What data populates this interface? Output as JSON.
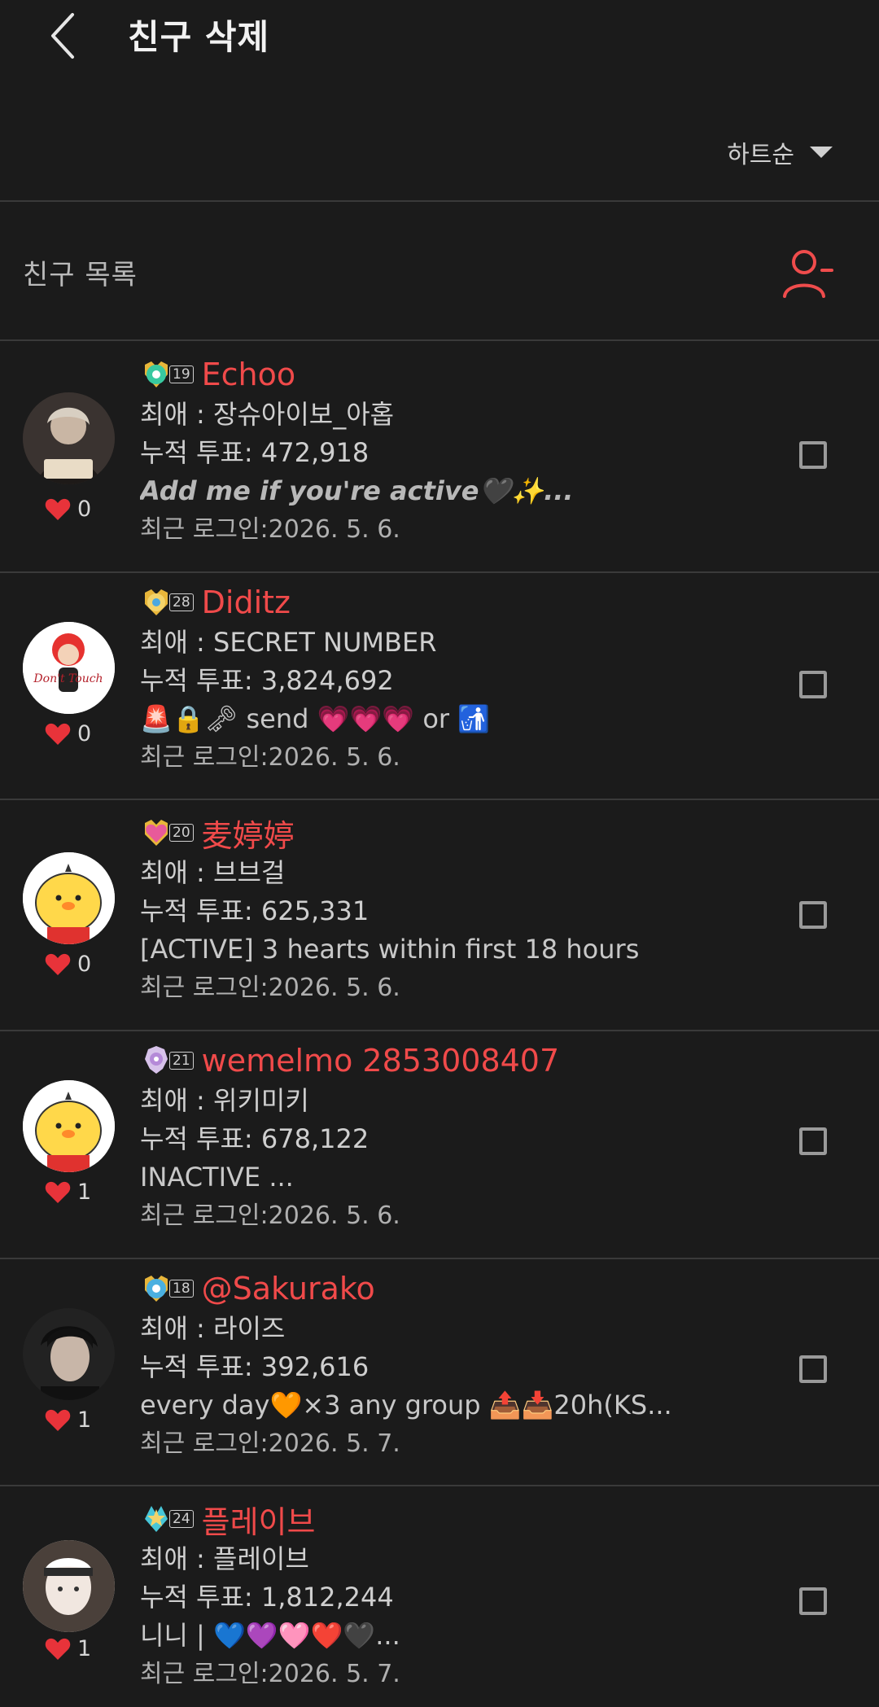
{
  "header": {
    "title": "친구 삭제"
  },
  "sort": {
    "label": "하트순"
  },
  "list": {
    "title": "친구 목록"
  },
  "friends": [
    {
      "name": "Echoo",
      "level": "19",
      "hearts": "0",
      "fav": "최애 : 장슈아이보_아홉",
      "votes": "누적 투표: 472,918",
      "status": "Add me if you're active🖤✨...",
      "login": "최근 로그인:2026. 5. 6.",
      "badge_color": "#38c9a0",
      "avatar": "photo-reading"
    },
    {
      "name": "Diditz",
      "level": "28",
      "hearts": "0",
      "fav": "최애 : SECRET NUMBER",
      "votes": "누적 투표: 3,824,692",
      "status": "🚨🔒🗝 send 💗💗💗 or 🚮",
      "login": "최근 로그인:2026. 5. 6.",
      "badge_color": "#e8b63a",
      "avatar": "dont-touch"
    },
    {
      "name": "麦婷婷",
      "level": "20",
      "hearts": "0",
      "fav": "최애 : 브브걸",
      "votes": "누적 투표: 625,331",
      "status": "[ACTIVE] 3 hearts within first 18 hours",
      "login": "최근 로그인:2026. 5. 6.",
      "badge_color": "#e85a9a",
      "avatar": "chick"
    },
    {
      "name": "wemelmo 2853008407",
      "level": "21",
      "hearts": "1",
      "fav": "최애 : 위키미키",
      "votes": "누적 투표: 678,122",
      "status": "INACTIVE ...",
      "login": "최근 로그인:2026. 5. 6.",
      "badge_color": "#b58ad8",
      "avatar": "chick"
    },
    {
      "name": "@Sakurako",
      "level": "18",
      "hearts": "1",
      "fav": "최애 : 라이즈",
      "votes": "누적 투표: 392,616",
      "status": "every day🧡×3   any group 📤📥20h(KS...",
      "login": "최근 로그인:2026. 5. 7.",
      "badge_color": "#4ab0e0",
      "avatar": "photo-dark"
    },
    {
      "name": "플레이브",
      "level": "24",
      "hearts": "1",
      "fav": "최애 : 플레이브",
      "votes": "누적 투표: 1,812,244",
      "status": "니니 | 💙💜🩷❤️🖤...",
      "login": "최근 로그인:2026. 5. 7.",
      "badge_color": "#47c6d8",
      "avatar": "photo-light"
    }
  ],
  "colors": {
    "accent": "#f04a4a",
    "background": "#1b1b1b",
    "divider": "#3a3a3a"
  }
}
